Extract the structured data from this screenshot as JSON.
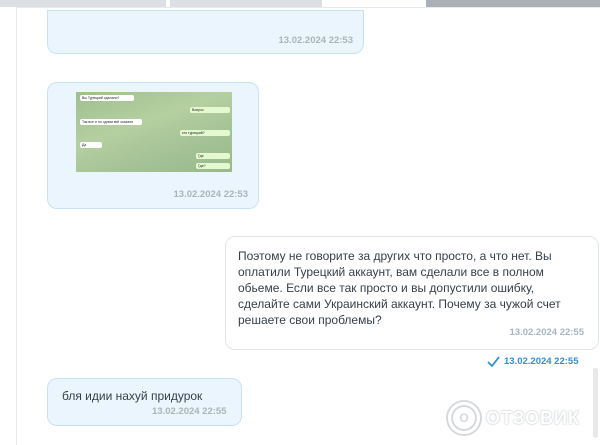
{
  "messages": [
    {
      "type": "incoming",
      "time": "13.02.2024 22:53"
    },
    {
      "type": "incoming-image",
      "time": "13.02.2024 22:53",
      "image_chat": {
        "lines": [
          {
            "text": "Вы Турецкий сделали?"
          },
          {
            "text": "Вопрос"
          },
          {
            "text": "Так все и по одним всё сказали"
          },
          {
            "text": "кто турецкий?"
          },
          {
            "text": "Да"
          },
          {
            "text": "Где"
          },
          {
            "text": "Где?"
          }
        ]
      }
    },
    {
      "type": "outgoing",
      "text": "Поэтому не говорите за других что просто, а что нет. Вы оплатили Турецкий аккаунт, вам сделали все в полном обьеме. Если все так просто и вы допустили ошибку, сделайте сами Украинский аккаунт. Почему за чужой счет решаете свои проблемы?",
      "time": "13.02.2024 22:55",
      "delivered_time": "13.02.2024 22:55"
    },
    {
      "type": "incoming",
      "text": "бля идии нахуй придурок",
      "time": "13.02.2024 22:55"
    }
  ],
  "watermark": {
    "text": "ОТЗОВИК",
    "mark": "О"
  },
  "colors": {
    "incoming_bg": "#eaf5fd",
    "incoming_border": "#c6e2f5",
    "accent": "#2f8fd8",
    "timestamp": "#a8b4bf"
  }
}
